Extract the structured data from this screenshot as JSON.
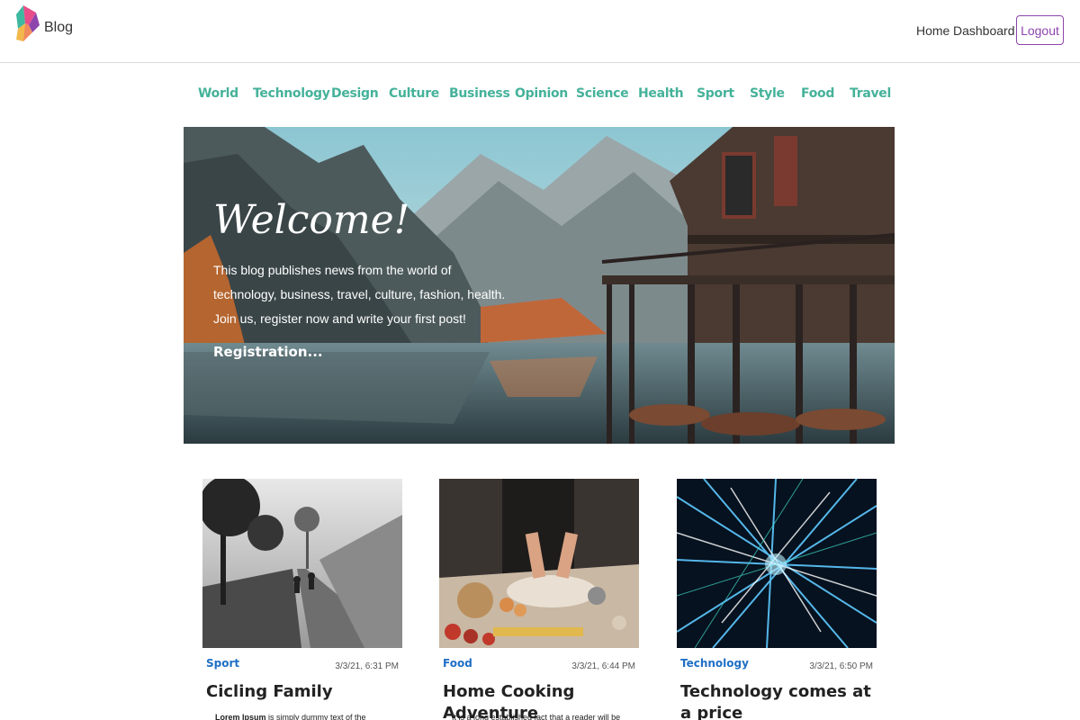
{
  "header": {
    "brand": "Blog",
    "nav": [
      "Home",
      "Dashboard"
    ],
    "logout_label": "Logout"
  },
  "categories": [
    "World",
    "Technology",
    "Design",
    "Culture",
    "Business",
    "Opinion",
    "Science",
    "Health",
    "Sport",
    "Style",
    "Food",
    "Travel"
  ],
  "hero": {
    "title": "Welcome!",
    "text": "This blog publishes news from the world of technology, business, travel, culture, fashion, health. Join us, register now and write your first post!",
    "link": "Registration..."
  },
  "cards": [
    {
      "category": "Sport",
      "date": "3/3/21, 6:31 PM",
      "title": "Cicling Family",
      "excerpt_bold": "Lorem Ipsum",
      "excerpt": " is simply dummy text of the"
    },
    {
      "category": "Food",
      "date": "3/3/21, 6:44 PM",
      "title": "Home Cooking Adventure",
      "excerpt_bold": "",
      "excerpt": "It is a long established fact that a reader will be"
    },
    {
      "category": "Technology",
      "date": "3/3/21, 6:50 PM",
      "title": "Technology comes at a price",
      "excerpt_bold": "",
      "excerpt": ""
    }
  ],
  "colors": {
    "accent": "#45b29a",
    "logout": "#8e44ad",
    "card_category": "#1f6fc5"
  },
  "icons": {
    "logo": "blog-logo-icon"
  }
}
